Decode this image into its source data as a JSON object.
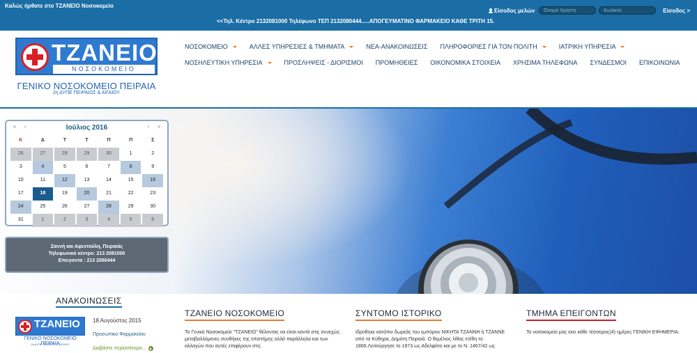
{
  "topbar": {
    "welcome": "Καλώς ήρθατε στο ΤΖΑΝΕΙΟ Νοσοκομείο",
    "marquee": "<<Τηλ. Κέντρο 2132081000 Τηλέφωνο ΤΕΠ 2132080444.....ΑΠΟΓΕΥΜΑΤΙΝΟ ΦΑΡΜΑΚΕΙΟ ΚΑΘΕ ΤΡΙΤΗ 15.",
    "login_label": "Είσοδος μελών",
    "username_placeholder": "Όνομα Χρήστη",
    "password_placeholder": "Κωδικός",
    "login_button": "Είσοδος >"
  },
  "logo": {
    "name": "ΤΖΑΝΕΙΟ",
    "sub": "ΝΟΣΟΚΟΜΕΙΟ",
    "tagline": "ΓΕΝΙΚΟ ΝΟΣΟΚΟΜΕΙΟ ΠΕΙΡΑΙΑ",
    "tagline2": "2η ΔΥΠΕ ΠΕΙΡΑΙΩΣ & ΑΙΓΑΙΟΥ"
  },
  "nav": {
    "row1": [
      {
        "label": "ΝΟΣΟΚΟΜΕΙΟ",
        "dropdown": true
      },
      {
        "label": "ΑΛΛΕΣ ΥΠΗΡΕΣΙΕΣ & ΤΜΗΜΑΤΑ",
        "dropdown": true
      },
      {
        "label": "ΝΕΑ-ΑΝΑΚΟΙΝΩΣΕΙΣ",
        "dropdown": false
      },
      {
        "label": "ΠΛΗΡΟΦΟΡΙΕΣ ΓΙΑ ΤΟΝ ΠΟΛΙΤΗ",
        "dropdown": true
      },
      {
        "label": "ΙΑΤΡΙΚΗ ΥΠΗΡΕΣΙΑ",
        "dropdown": true
      }
    ],
    "row2": [
      {
        "label": "ΝΟΣΗΛΕΥΤΙΚΗ ΥΠΗΡΕΣΙΑ",
        "dropdown": true
      },
      {
        "label": "ΠΡΟΣΛΗΨΕΙΣ - ΔΙΟΡΙΣΜΟΙ",
        "dropdown": false
      },
      {
        "label": "ΠΡΟΜΗΘΕΙΕΣ",
        "dropdown": false
      },
      {
        "label": "ΟΙΚΟΝΟΜΙΚΑ ΣΤΟΙΧΕΙΑ",
        "dropdown": false
      },
      {
        "label": "ΧΡΗΣΙΜΑ ΤΗΛΕΦΩΝΑ",
        "dropdown": false
      },
      {
        "label": "ΣΥΝΔΕΣΜΟΙ",
        "dropdown": false
      },
      {
        "label": "ΕΠΙΚΟΙΝΩΝΙΑ",
        "dropdown": false
      }
    ]
  },
  "calendar": {
    "prev_year": "«",
    "prev_month": "‹",
    "next_month": "›",
    "next_year": "»",
    "title": "Ιούλιος 2016",
    "weekdays": [
      "Κ",
      "Δ",
      "Τ",
      "Τ",
      "Π",
      "Π",
      "Σ"
    ],
    "weeks": [
      [
        {
          "d": "26",
          "o": true
        },
        {
          "d": "27",
          "o": true
        },
        {
          "d": "28",
          "o": true
        },
        {
          "d": "29",
          "o": true
        },
        {
          "d": "30",
          "o": true
        },
        {
          "d": "1"
        },
        {
          "d": "2"
        }
      ],
      [
        {
          "d": "3"
        },
        {
          "d": "4",
          "h": true
        },
        {
          "d": "5"
        },
        {
          "d": "6"
        },
        {
          "d": "7"
        },
        {
          "d": "8",
          "h": true
        },
        {
          "d": "9"
        }
      ],
      [
        {
          "d": "10"
        },
        {
          "d": "11"
        },
        {
          "d": "12",
          "h": true
        },
        {
          "d": "13"
        },
        {
          "d": "14"
        },
        {
          "d": "15"
        },
        {
          "d": "16",
          "h": true
        }
      ],
      [
        {
          "d": "17"
        },
        {
          "d": "18",
          "t": true
        },
        {
          "d": "19"
        },
        {
          "d": "20",
          "h": true
        },
        {
          "d": "21"
        },
        {
          "d": "22"
        },
        {
          "d": "23"
        }
      ],
      [
        {
          "d": "24",
          "h": true
        },
        {
          "d": "25"
        },
        {
          "d": "26"
        },
        {
          "d": "27"
        },
        {
          "d": "28",
          "h": true
        },
        {
          "d": "29"
        },
        {
          "d": "30"
        }
      ],
      [
        {
          "d": "31"
        },
        {
          "d": "1",
          "o": true
        },
        {
          "d": "2",
          "o": true
        },
        {
          "d": "3",
          "o": true
        },
        {
          "d": "4",
          "o": true
        },
        {
          "d": "5",
          "o": true
        },
        {
          "d": "6",
          "o": true
        }
      ]
    ]
  },
  "contact": {
    "address": "Ζαννή και Αφεντούλη, Πειραιάς",
    "phone": "Τηλεφωνικό κέντρο: 213 2081000",
    "emergency": "Επειγοντα : 213 2080444"
  },
  "announcements": {
    "title": "ΑΝΑΚΟΙΝΩΣΕΙΣ",
    "date": "18 Αυγούστος 2015",
    "link": "Προσωπικο Φαρμακείου",
    "more": "Διαβάστε περισσότερα..."
  },
  "columns": [
    {
      "title": "ΤΖΑΝΕΙΟ ΝΟΣΟΚΟΜΕΙΟ",
      "text": "Το Γενικό Νοσοκομείο \"ΤΖΑΝΕΙΟ\" θέλοντας να είναι κοντά στις συνεχώς μεταβαλλόμενες συνθήκες της επιστήμης αλλά παράλληλα και των αλλαγών που αυτές επιφέρουν στις"
    },
    {
      "title": "ΣΥΝΤΟΜΟ ΙΣΤΟΡΙΚΟ",
      "text": "Ιδρύθηκε κατόπιν δωρεάς του εμπόρου ΝΙΚΗΤΑ ΤΖΑΝΝΗ ή ΤΖΑΝΝΕ από τα Κύθηρα, Δημότη Πειραιά. Ο θεμέλιος λίθος ετέθη το 1866.Λειτούργησε το 1873 ως Αδελφάτο και με το Ν. 1467/42 ως"
    },
    {
      "title": "ΤΜΗΜΑ ΕΠΕΙΓΟΝΤΩΝ",
      "text": "Το νοσοκομείο μας εκει κάθε τέσσερεις(4) ημέρες ΓΕΝΙΚΗ ΕΦΗΜΕΡΙΑ."
    }
  ],
  "colors": {
    "topbar": "#1b6da5",
    "accent": "#e57b2d",
    "logo_blue": "#2f7ad1",
    "logo_red": "#d91f26",
    "today": "#1b5c8c",
    "contact_bg": "#5d6875"
  }
}
